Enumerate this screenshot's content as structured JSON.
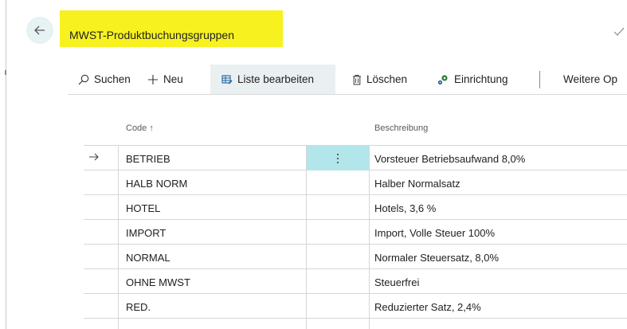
{
  "header": {
    "title": "MWST-Produktbuchungsgruppen",
    "highlight_color": "#f7f21f"
  },
  "toolbar": {
    "search_label": "Suchen",
    "new_label": "Neu",
    "edit_list_label": "Liste bearbeiten",
    "delete_label": "Löschen",
    "setup_label": "Einrichtung",
    "more_label": "Weitere Op"
  },
  "table": {
    "columns": {
      "code": "Code ↑",
      "description": "Beschreibung"
    },
    "rows": [
      {
        "code": "BETRIEB",
        "description": "Vorsteuer Betriebsaufwand 8,0%"
      },
      {
        "code": "HALB NORM",
        "description": "Halber Normalsatz"
      },
      {
        "code": "HOTEL",
        "description": "Hotels, 3,6 %"
      },
      {
        "code": "IMPORT",
        "description": "Import, Volle Steuer 100%"
      },
      {
        "code": "NORMAL",
        "description": "Normaler Steuersatz, 8,0%"
      },
      {
        "code": "OHNE MWST",
        "description": "Steuerfrei"
      },
      {
        "code": "RED.",
        "description": "Reduzierter Satz, 2,4%"
      }
    ],
    "selected_row_color": "#b2e6ea"
  },
  "icons": [
    "back-arrow-icon",
    "check-icon",
    "search-icon",
    "plus-icon",
    "edit-list-icon",
    "trash-icon",
    "settings-icon",
    "row-arrow-icon",
    "more-vertical-icon"
  ]
}
